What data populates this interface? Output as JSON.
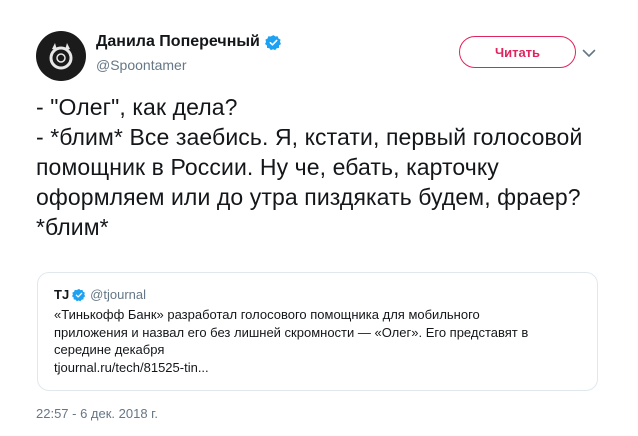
{
  "author": {
    "name": "Данила Поперечный",
    "handle": "@Spoontamer"
  },
  "follow_button": {
    "label": "Читать"
  },
  "tweet": {
    "text": "- \"Олег\", как дела?\n- *блим* Все заебись. Я, кстати, первый голосовой помощник в России. Ну че, ебать, карточку оформляем или до утра пиздякать будем, фраер? *блим*"
  },
  "quoted_tweet": {
    "name": "TJ",
    "handle": "@tjournal",
    "text": "«Тинькофф Банк» разработал голосового помощника для мобильного\nприложения и назвал его без лишней скромности — «Олег». Его представят в\nсередине декабря\ntjournal.ru/tech/81525-tin..."
  },
  "timestamp": "22:57 - 6 дек. 2018 г.",
  "icons": {
    "avatar": "avatar-logo",
    "verified": "verified-badge-icon",
    "caret": "chevron-down-icon"
  },
  "colors": {
    "accent": "#e0245e",
    "verified": "#1da1f2",
    "secondary_text": "#657786",
    "border": "#e1e8ed"
  }
}
